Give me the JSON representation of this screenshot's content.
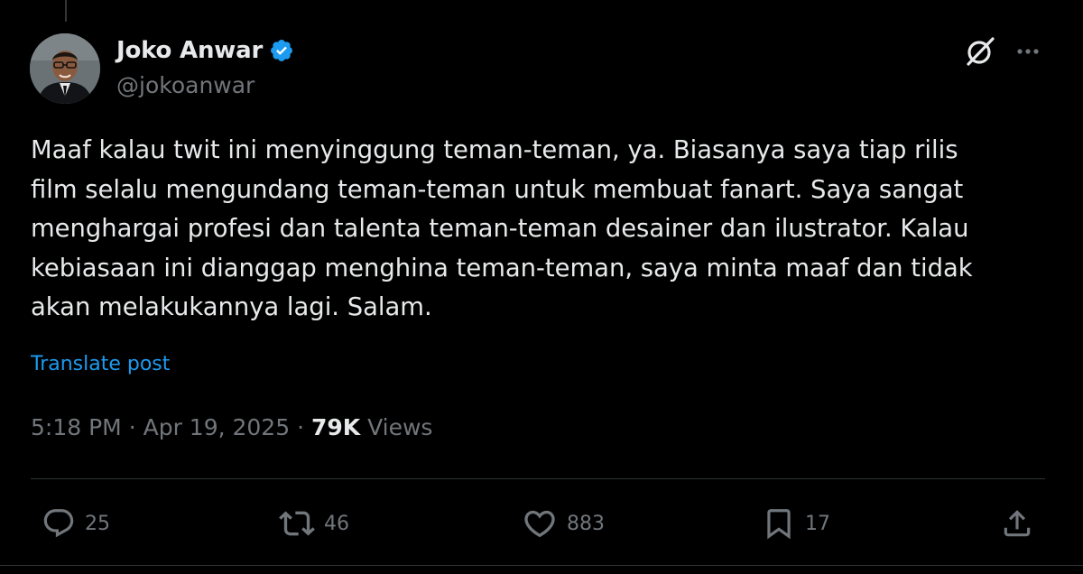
{
  "author": {
    "display_name": "Joko Anwar",
    "handle": "@jokoanwar",
    "verified": true,
    "verified_color": "#1d9bf0"
  },
  "tweet": {
    "lines": [
      "Maaf kalau twit ini menyinggung teman-teman, ya. Biasanya saya tiap rilis",
      "film selalu mengundang teman-teman untuk membuat fanart. Saya sangat",
      "menghargai profesi dan talenta teman-teman desainer dan ilustrator. Kalau",
      "kebiasaan ini dianggap menghina teman-teman, saya minta maaf dan tidak",
      "akan melakukannya lagi. Salam."
    ],
    "translate_label": "Translate post"
  },
  "meta": {
    "time": "5:18 PM",
    "separator": "·",
    "date": "Apr 19, 2025",
    "views_count": "79K",
    "views_label": "Views"
  },
  "actions": {
    "replies": "25",
    "reposts": "46",
    "likes": "883",
    "bookmarks": "17"
  },
  "icons": {
    "top_right": [
      "grok-icon",
      "more-icon"
    ],
    "action_bar": [
      "reply-icon",
      "repost-icon",
      "like-icon",
      "bookmark-icon",
      "share-icon"
    ]
  },
  "colors": {
    "background": "#000000",
    "text_primary": "#e7e9ea",
    "text_secondary": "#71767b",
    "link": "#1d9bf0",
    "divider": "#2f3336"
  }
}
